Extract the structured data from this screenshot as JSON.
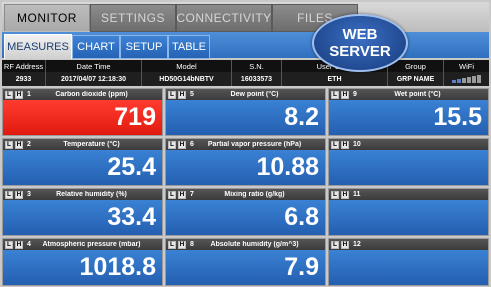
{
  "top_tabs": [
    {
      "label": "MONITOR",
      "active": true
    },
    {
      "label": "SETTINGS",
      "active": false
    },
    {
      "label": "CONNECTIVITY",
      "active": false
    },
    {
      "label": "FILES",
      "active": false
    }
  ],
  "sub_tabs": [
    {
      "label": "MEASURES",
      "active": true
    },
    {
      "label": "CHART",
      "active": false
    },
    {
      "label": "SETUP",
      "active": false
    },
    {
      "label": "TABLE",
      "active": false
    }
  ],
  "web_server": {
    "line1": "WEB",
    "line2": "SERVER"
  },
  "info": {
    "headers": [
      "RF Address",
      "Date Time",
      "Model",
      "S.N.",
      "User Code",
      "Group",
      "WiFi"
    ],
    "values": [
      "2933",
      "2017/04/07 12:18:30",
      "HD50G14bNBTV",
      "16033573",
      "ETH",
      "GRP NAME",
      ""
    ]
  },
  "lh": {
    "l": "L",
    "h": "H"
  },
  "cells": [
    {
      "num": "1",
      "name": "Carbon dioxide (ppm)",
      "value": "719",
      "alarm": true
    },
    {
      "num": "5",
      "name": "Dew point (°C)",
      "value": "8.2",
      "alarm": false
    },
    {
      "num": "9",
      "name": "Wet point (°C)",
      "value": "15.5",
      "alarm": false
    },
    {
      "num": "2",
      "name": "Temperature (°C)",
      "value": "25.4",
      "alarm": false
    },
    {
      "num": "6",
      "name": "Partial vapor pressure (hPa)",
      "value": "10.88",
      "alarm": false
    },
    {
      "num": "10",
      "name": "",
      "value": "",
      "alarm": false
    },
    {
      "num": "3",
      "name": "Relative humidity (%)",
      "value": "33.4",
      "alarm": false
    },
    {
      "num": "7",
      "name": "Mixing ratio (g/kg)",
      "value": "6.8",
      "alarm": false
    },
    {
      "num": "11",
      "name": "",
      "value": "",
      "alarm": false
    },
    {
      "num": "4",
      "name": "Atmospheric pressure (mbar)",
      "value": "1018.8",
      "alarm": false
    },
    {
      "num": "8",
      "name": "Absolute humidity (g/m^3)",
      "value": "7.9",
      "alarm": false
    },
    {
      "num": "12",
      "name": "",
      "value": "",
      "alarm": false
    }
  ]
}
